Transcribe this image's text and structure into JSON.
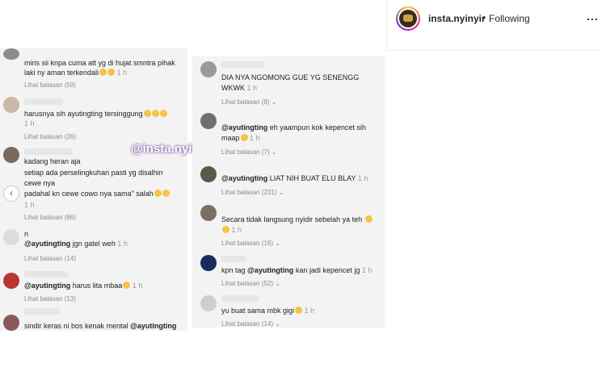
{
  "header": {
    "username": "insta.nyinyir",
    "separator": "•",
    "follow_status": "Following",
    "more": "..."
  },
  "watermark": "@insta.nyinyir",
  "left_comments": [
    {
      "line1": "miris sii knpa cuma att yg di hujat smntra pihak",
      "line2": "laki ny aman terkendali",
      "time": "1 h",
      "replies": "Lihat balasan (59)"
    },
    {
      "line1": "harusnya sih ayutingting tersinggung",
      "time": "1 h",
      "replies": "Lihat balasan (26)"
    },
    {
      "line1": "kadang heran aja",
      "line2": "setiap ada perselingkuhan pasti yg disalhin",
      "line3": "cewe nya",
      "line4": "padahal kn cewe cowo nya sama\" salah",
      "time": "1 h",
      "replies": "Lihat balasan (66)"
    },
    {
      "name": "n",
      "mention": "@ayutingting",
      "text": " jgn gatel weh",
      "time": "1 h",
      "replies": "Lihat balasan (14)"
    },
    {
      "mention": "@ayutingting",
      "text": " harus lita mbaa",
      "time": "1 h",
      "replies": "Lihat balasan (13)"
    },
    {
      "line1": "sindir keras ni bos kenak mental ",
      "mention": "@ayutingting"
    }
  ],
  "right_comments": [
    {
      "line1": "DIA NYA NGOMONG GUE YG SENENGG",
      "line2": "WKWK",
      "time": "1 h",
      "replies": "Lihat balasan (8)"
    },
    {
      "mention": "@ayutingting",
      "text": " eh yaampun kok kepencet sih",
      "line2": "maap",
      "time": "1 h",
      "replies": "Lihat balasan (7)"
    },
    {
      "mention": "@ayutingting",
      "text": " LIAT NIH BUAT ELU BLAY",
      "time": "1 h",
      "replies": "Lihat balasan (231)"
    },
    {
      "line1": "Secara tidak langsung nyidir sebelah ya teh",
      "time": "1 h",
      "replies": "Lihat balasan (16)"
    },
    {
      "pre": "kpn tag ",
      "mention": "@ayutingting",
      "text": " kan jadi kepencet jg",
      "time": "1 h",
      "replies": "Lihat balasan (52)"
    },
    {
      "line1": "yu buat sama mbk gigi",
      "time": "1 h",
      "replies": "Lihat balasan (14)"
    }
  ]
}
